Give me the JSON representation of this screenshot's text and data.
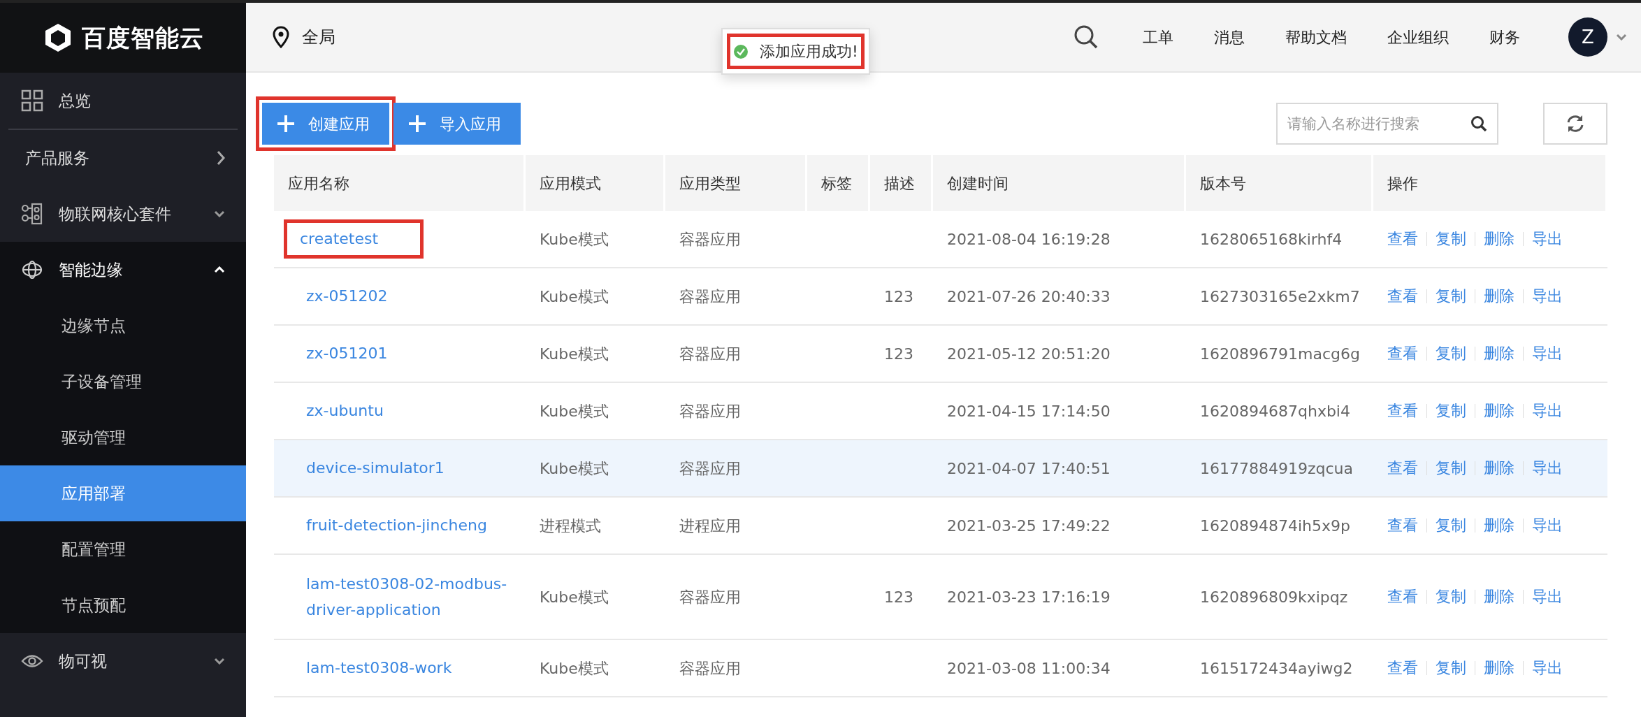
{
  "logo": {
    "text": "百度智能云"
  },
  "sidebar": {
    "items": [
      {
        "kind": "link",
        "label": "总览"
      },
      {
        "kind": "divider"
      },
      {
        "kind": "submenu",
        "label": "产品服务"
      },
      {
        "kind": "group",
        "label": "物联网核心套件",
        "expanded": false
      },
      {
        "kind": "group",
        "label": "智能边缘",
        "expanded": true,
        "children": [
          {
            "label": "边缘节点",
            "selected": false
          },
          {
            "label": "子设备管理",
            "selected": false
          },
          {
            "label": "驱动管理",
            "selected": false
          },
          {
            "label": "应用部署",
            "selected": true
          },
          {
            "label": "配置管理",
            "selected": false
          },
          {
            "label": "节点预配",
            "selected": false
          }
        ]
      },
      {
        "kind": "group",
        "label": "物可视",
        "expanded": false
      }
    ]
  },
  "header": {
    "region": "全局",
    "links": [
      "工单",
      "消息",
      "帮助文档",
      "企业组织",
      "财务"
    ],
    "avatar": "Z"
  },
  "toast": {
    "text": "添加应用成功!",
    "annotated": true
  },
  "toolbar": {
    "buttons": [
      {
        "label": "创建应用",
        "annotated": true
      },
      {
        "label": "导入应用",
        "annotated": false
      }
    ],
    "search": {
      "placeholder": "请输入名称进行搜索"
    }
  },
  "table": {
    "columns": [
      "应用名称",
      "应用模式",
      "应用类型",
      "标签",
      "描述",
      "创建时间",
      "版本号",
      "操作"
    ],
    "rows": [
      {
        "name": "createtest",
        "annotated": true,
        "highlighted": false,
        "mode": "Kube模式",
        "type": "容器应用",
        "tags": "",
        "description": "",
        "created": "2021-08-04 16:19:28",
        "version": "1628065168kirhf4",
        "actions": [
          "查看",
          "复制",
          "删除",
          "导出"
        ]
      },
      {
        "name": "zx-051202",
        "annotated": false,
        "highlighted": false,
        "mode": "Kube模式",
        "type": "容器应用",
        "tags": "",
        "description": "123",
        "created": "2021-07-26 20:40:33",
        "version": "1627303165e2xkm7",
        "actions": [
          "查看",
          "复制",
          "删除",
          "导出"
        ]
      },
      {
        "name": "zx-051201",
        "annotated": false,
        "highlighted": false,
        "mode": "Kube模式",
        "type": "容器应用",
        "tags": "",
        "description": "123",
        "created": "2021-05-12 20:51:20",
        "version": "1620896791macg6g",
        "actions": [
          "查看",
          "复制",
          "删除",
          "导出"
        ]
      },
      {
        "name": "zx-ubuntu",
        "annotated": false,
        "highlighted": false,
        "mode": "Kube模式",
        "type": "容器应用",
        "tags": "",
        "description": "",
        "created": "2021-04-15 17:14:50",
        "version": "1620894687qhxbi4",
        "actions": [
          "查看",
          "复制",
          "删除",
          "导出"
        ]
      },
      {
        "name": "device-simulator1",
        "annotated": false,
        "highlighted": true,
        "mode": "Kube模式",
        "type": "容器应用",
        "tags": "",
        "description": "",
        "created": "2021-04-07 17:40:51",
        "version": "16177884919zqcua",
        "actions": [
          "查看",
          "复制",
          "删除",
          "导出"
        ]
      },
      {
        "name": "fruit-detection-jincheng",
        "annotated": false,
        "highlighted": false,
        "mode": "进程模式",
        "type": "进程应用",
        "tags": "",
        "description": "",
        "created": "2021-03-25 17:49:22",
        "version": "1620894874ih5x9p",
        "actions": [
          "查看",
          "复制",
          "删除",
          "导出"
        ]
      },
      {
        "name": "lam-test0308-02-modbus-driver-application",
        "annotated": false,
        "highlighted": false,
        "mode": "Kube模式",
        "type": "容器应用",
        "tags": "",
        "description": "123",
        "created": "2021-03-23 17:16:19",
        "version": "1620896809kxipqz",
        "actions": [
          "查看",
          "复制",
          "删除",
          "导出"
        ]
      },
      {
        "name": "lam-test0308-work",
        "annotated": false,
        "highlighted": false,
        "mode": "Kube模式",
        "type": "容器应用",
        "tags": "",
        "description": "",
        "created": "2021-03-08 11:00:34",
        "version": "1615172434ayiwg2",
        "actions": [
          "查看",
          "复制",
          "删除",
          "导出"
        ]
      }
    ]
  }
}
